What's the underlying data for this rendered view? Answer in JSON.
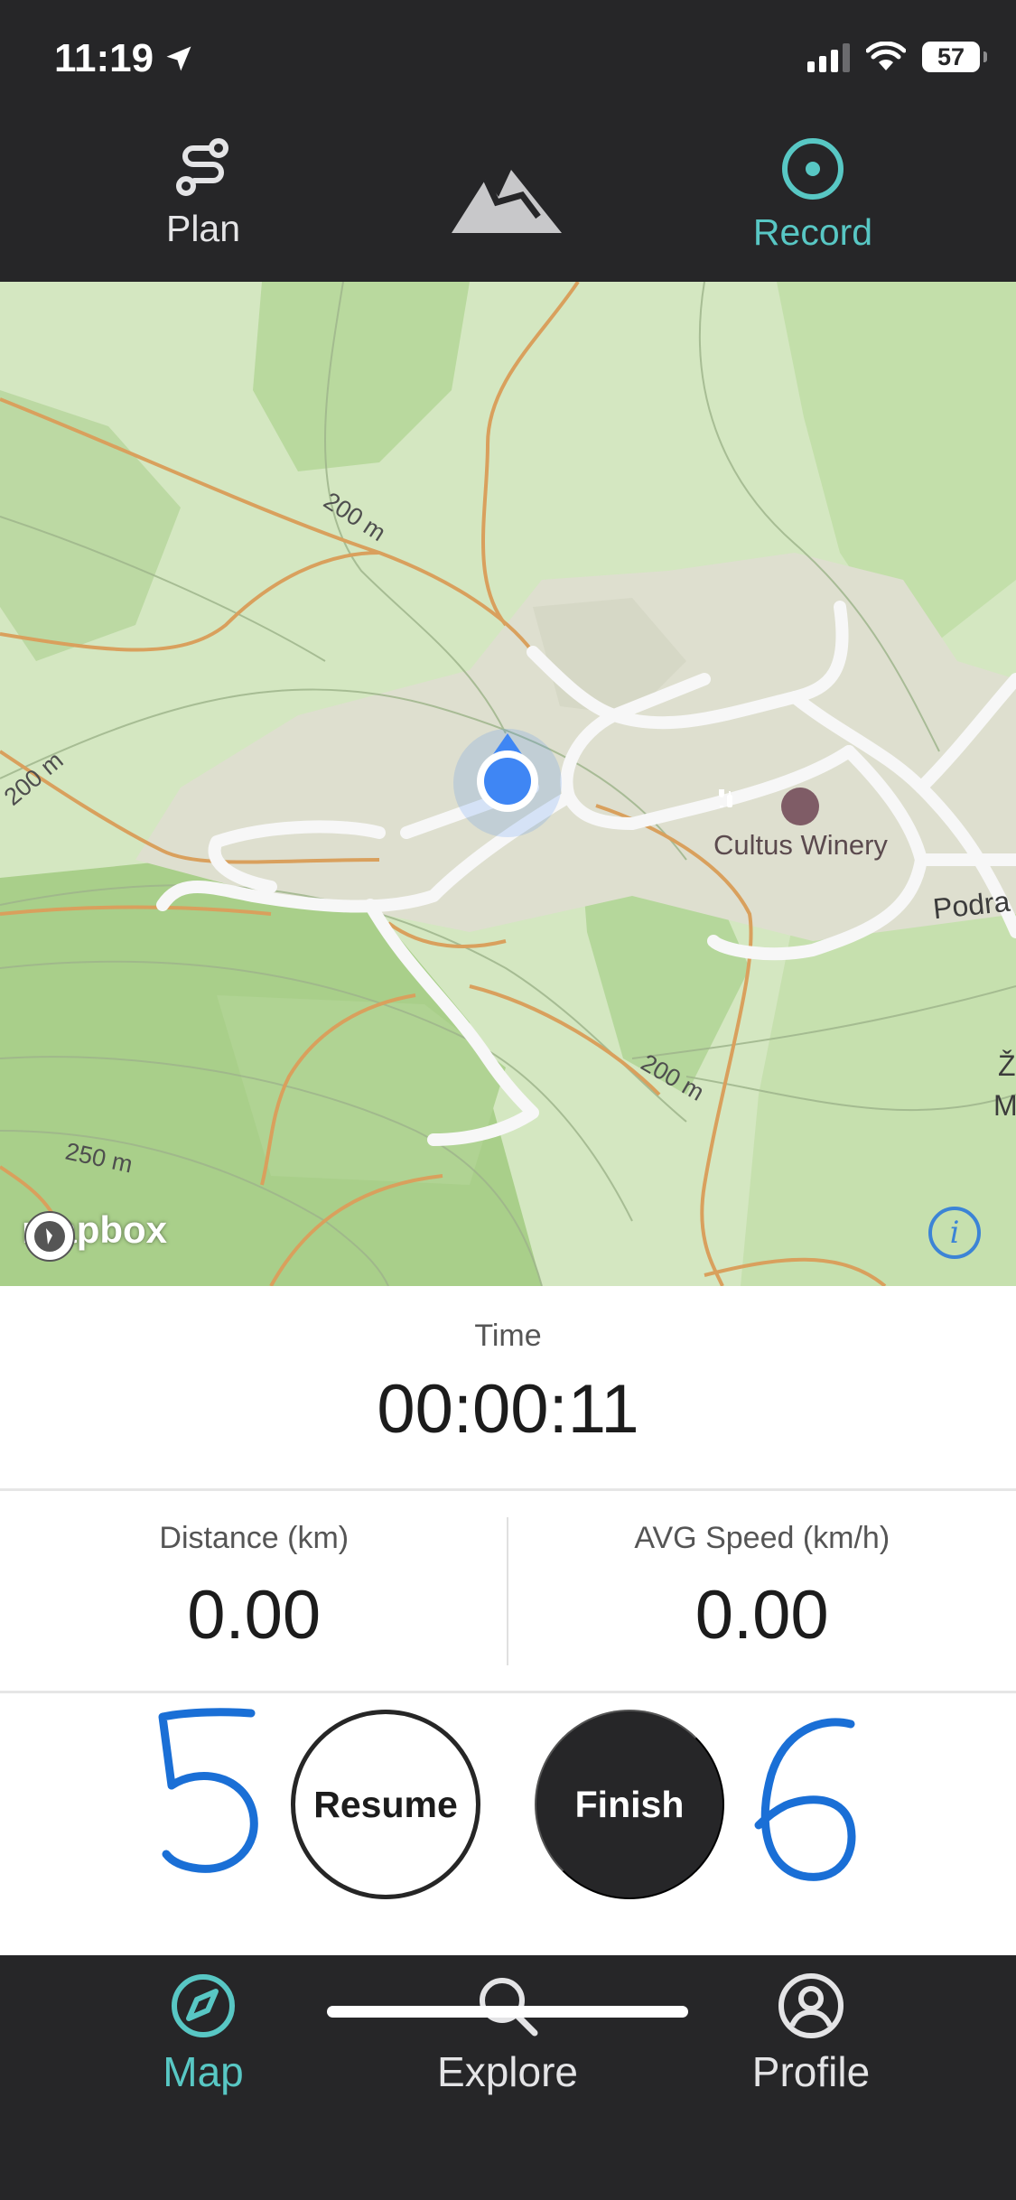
{
  "status_bar": {
    "time": "11:19",
    "battery": "57",
    "icons": [
      "location-arrow-icon",
      "signal-icon",
      "wifi-icon",
      "battery-icon"
    ]
  },
  "top_nav": {
    "plan_label": "Plan",
    "record_label": "Record",
    "active": "Record",
    "icons": {
      "plan": "route-icon",
      "center": "mountain-logo-icon",
      "record": "record-target-icon"
    }
  },
  "map": {
    "contour_labels": [
      "200 m",
      "200 m",
      "200 m",
      "250 m"
    ],
    "poi_name": "Cultus Winery",
    "road_label": "Podra",
    "edge_label_1": "Ž",
    "edge_label_2": "M",
    "attribution": "mapbox"
  },
  "stats": {
    "time_label": "Time",
    "time_value": "00:00:11",
    "distance_label": "Distance (km)",
    "distance_value": "0.00",
    "speed_label": "AVG Speed (km/h)",
    "speed_value": "0.00"
  },
  "actions": {
    "resume_label": "Resume",
    "finish_label": "Finish"
  },
  "annotations": {
    "left": "5",
    "right": "6",
    "color": "#1a6fd6"
  },
  "bottom_tabs": {
    "map_label": "Map",
    "explore_label": "Explore",
    "profile_label": "Profile",
    "active": "Map"
  },
  "colors": {
    "accent": "#58c7c4",
    "bar": "#262628",
    "location": "#3f86f4"
  }
}
